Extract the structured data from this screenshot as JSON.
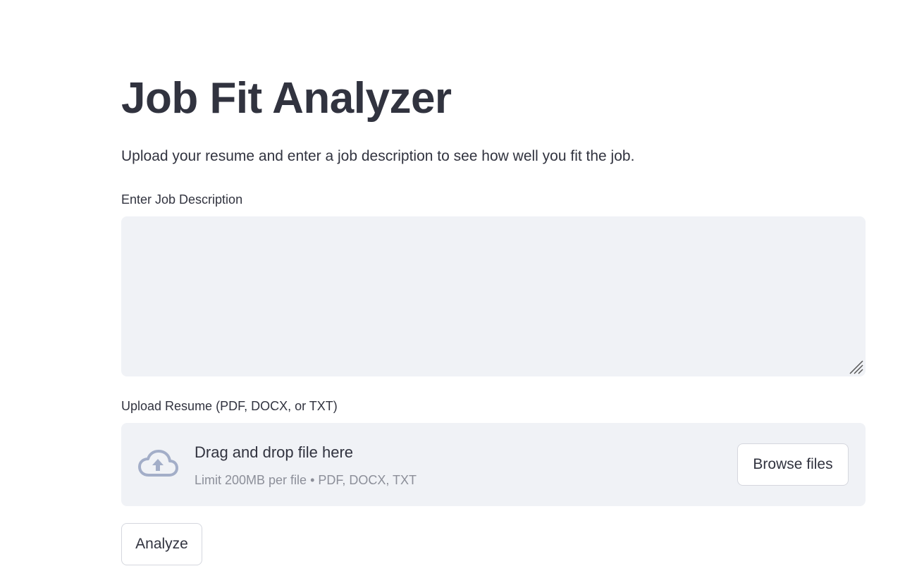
{
  "page": {
    "title": "Job Fit Analyzer",
    "subtitle": "Upload your resume and enter a job description to see how well you fit the job."
  },
  "job_description": {
    "label": "Enter Job Description",
    "value": "",
    "placeholder": ""
  },
  "resume_upload": {
    "label": "Upload Resume (PDF, DOCX, or TXT)",
    "dropzone_title": "Drag and drop file here",
    "dropzone_limit": "Limit 200MB per file • PDF, DOCX, TXT",
    "browse_label": "Browse files",
    "icon": "cloud-upload-icon"
  },
  "actions": {
    "analyze_label": "Analyze"
  },
  "colors": {
    "text": "#31333f",
    "input_bg": "#f0f2f6",
    "muted_text": "#8c8f99",
    "icon": "#a3aec8",
    "button_border": "#d5d7de"
  }
}
